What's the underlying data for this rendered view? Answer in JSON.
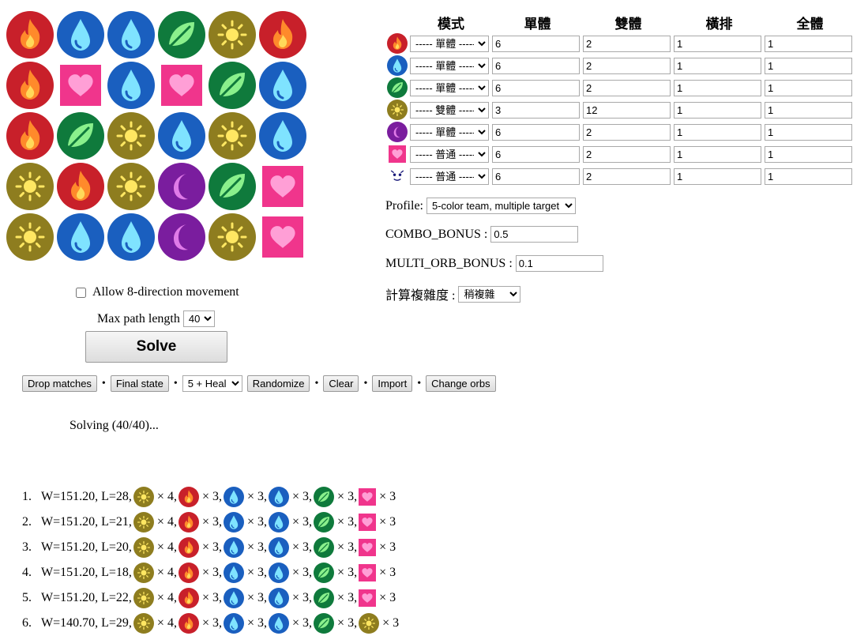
{
  "colors": {
    "fire": "#c8202a",
    "water": "#1a5fbf",
    "wood": "#0f7a3c",
    "light": "#8e7d1f",
    "dark": "#7a1d9e",
    "heart": "#f0358c"
  },
  "board": [
    [
      "fire",
      "water",
      "water",
      "wood",
      "light",
      "fire"
    ],
    [
      "fire",
      "heart",
      "water",
      "heart",
      "wood",
      "water"
    ],
    [
      "fire",
      "wood",
      "light",
      "water",
      "light",
      "water"
    ],
    [
      "light",
      "fire",
      "light",
      "dark",
      "wood",
      "heart"
    ],
    [
      "light",
      "water",
      "water",
      "dark",
      "light",
      "heart"
    ]
  ],
  "controls": {
    "allow_8dir_label": "Allow 8-direction movement",
    "max_path_label": "Max path length",
    "max_path_value": "40",
    "solve_label": "Solve"
  },
  "toolbar": {
    "drop_matches": "Drop matches",
    "final_state": "Final state",
    "bullet": "•",
    "sort_value": "5 + Heal",
    "randomize": "Randomize",
    "clear": "Clear",
    "import": "Import",
    "change_orbs": "Change orbs"
  },
  "status": "Solving (40/40)...",
  "results": [
    {
      "num": "1.",
      "text": "W=151.20, L=28,",
      "items": [
        {
          "orb": "light",
          "count": "× 4,"
        },
        {
          "orb": "fire",
          "count": "× 3,"
        },
        {
          "orb": "water",
          "count": "× 3,"
        },
        {
          "orb": "water",
          "count": "× 3,"
        },
        {
          "orb": "wood",
          "count": "× 3,"
        },
        {
          "orb": "heart",
          "count": "× 3"
        }
      ]
    },
    {
      "num": "2.",
      "text": "W=151.20, L=21,",
      "items": [
        {
          "orb": "light",
          "count": "× 4,"
        },
        {
          "orb": "fire",
          "count": "× 3,"
        },
        {
          "orb": "water",
          "count": "× 3,"
        },
        {
          "orb": "water",
          "count": "× 3,"
        },
        {
          "orb": "wood",
          "count": "× 3,"
        },
        {
          "orb": "heart",
          "count": "× 3"
        }
      ]
    },
    {
      "num": "3.",
      "text": "W=151.20, L=20,",
      "items": [
        {
          "orb": "light",
          "count": "× 4,"
        },
        {
          "orb": "fire",
          "count": "× 3,"
        },
        {
          "orb": "water",
          "count": "× 3,"
        },
        {
          "orb": "water",
          "count": "× 3,"
        },
        {
          "orb": "wood",
          "count": "× 3,"
        },
        {
          "orb": "heart",
          "count": "× 3"
        }
      ]
    },
    {
      "num": "4.",
      "text": "W=151.20, L=18,",
      "items": [
        {
          "orb": "light",
          "count": "× 4,"
        },
        {
          "orb": "fire",
          "count": "× 3,"
        },
        {
          "orb": "water",
          "count": "× 3,"
        },
        {
          "orb": "water",
          "count": "× 3,"
        },
        {
          "orb": "wood",
          "count": "× 3,"
        },
        {
          "orb": "heart",
          "count": "× 3"
        }
      ]
    },
    {
      "num": "5.",
      "text": "W=151.20, L=22,",
      "items": [
        {
          "orb": "light",
          "count": "× 4,"
        },
        {
          "orb": "fire",
          "count": "× 3,"
        },
        {
          "orb": "water",
          "count": "× 3,"
        },
        {
          "orb": "water",
          "count": "× 3,"
        },
        {
          "orb": "wood",
          "count": "× 3,"
        },
        {
          "orb": "heart",
          "count": "× 3"
        }
      ]
    },
    {
      "num": "6.",
      "text": "W=140.70, L=29,",
      "items": [
        {
          "orb": "light",
          "count": "× 4,"
        },
        {
          "orb": "fire",
          "count": "× 3,"
        },
        {
          "orb": "water",
          "count": "× 3,"
        },
        {
          "orb": "water",
          "count": "× 3,"
        },
        {
          "orb": "wood",
          "count": "× 3,"
        },
        {
          "orb": "light",
          "count": "× 3"
        }
      ]
    }
  ],
  "settings": {
    "headers": [
      "模式",
      "單體",
      "雙體",
      "橫排",
      "全體"
    ],
    "rows": [
      {
        "orb": "fire",
        "mode": "----- 單體 -----",
        "single": "6",
        "double": "2",
        "row": "1",
        "all": "1"
      },
      {
        "orb": "water",
        "mode": "----- 單體 -----",
        "single": "6",
        "double": "2",
        "row": "1",
        "all": "1"
      },
      {
        "orb": "wood",
        "mode": "----- 單體 -----",
        "single": "6",
        "double": "2",
        "row": "1",
        "all": "1"
      },
      {
        "orb": "light",
        "mode": "----- 雙體 -----",
        "single": "3",
        "double": "12",
        "row": "1",
        "all": "1"
      },
      {
        "orb": "dark",
        "mode": "----- 單體 -----",
        "single": "6",
        "double": "2",
        "row": "1",
        "all": "1"
      },
      {
        "orb": "heart",
        "mode": "----- 普通 -----",
        "single": "6",
        "double": "2",
        "row": "1",
        "all": "1"
      },
      {
        "orb": "jammer",
        "mode": "----- 普通 -----",
        "single": "6",
        "double": "2",
        "row": "1",
        "all": "1"
      }
    ]
  },
  "profile": {
    "label": "Profile:",
    "value": "5-color team, multiple target"
  },
  "combo_bonus": {
    "label": "COMBO_BONUS :",
    "value": "0.5"
  },
  "multi_orb_bonus": {
    "label": "MULTI_ORB_BONUS :",
    "value": "0.1"
  },
  "complexity": {
    "label": "計算複雜度 :",
    "value": "稍複雜"
  }
}
